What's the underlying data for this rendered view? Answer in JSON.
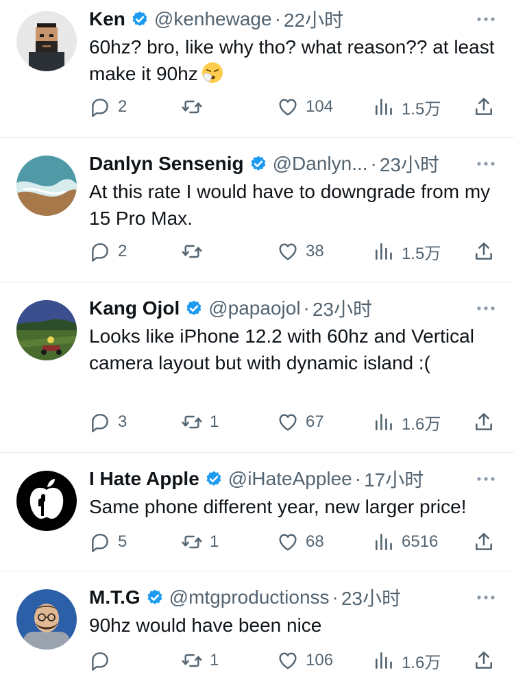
{
  "tweets": [
    {
      "name": "Ken",
      "handle": "@kenhewage",
      "time": "22小时",
      "text": "60hz? bro, like why tho? what reason?? at least make it 90hz",
      "replies": "2",
      "retweets": "",
      "likes": "104",
      "views": "1.5万",
      "avatar": "pixel-art-man-avatar"
    },
    {
      "name": "Danlyn Sensenig",
      "handle": "@Danlyn...",
      "time": "23小时",
      "text": "At this rate I would have to downgrade from my 15 Pro Max.",
      "replies": "2",
      "retweets": "",
      "likes": "38",
      "views": "1.5万",
      "avatar": "beach-aerial-avatar"
    },
    {
      "name": "Kang Ojol",
      "handle": "@papaojol",
      "time": "23小时",
      "text": "Looks like iPhone 12.2 with 60hz and Vertical camera layout but with dynamic island :(",
      "replies": "3",
      "retweets": "1",
      "likes": "67",
      "views": "1.6万",
      "avatar": "motorbike-landscape-avatar"
    },
    {
      "name": "I Hate Apple",
      "handle": "@iHateApplee",
      "time": "17小时",
      "text": "Same phone different year, new larger price!",
      "replies": "5",
      "retweets": "1",
      "likes": "68",
      "views": "6516",
      "avatar": "apple-logo-avatar"
    },
    {
      "name": "M.T.G",
      "handle": "@mtgproductionss",
      "time": "23小时",
      "text": "90hz would have been nice",
      "replies": "",
      "retweets": "1",
      "likes": "106",
      "views": "1.6万",
      "avatar": "man-glasses-avatar"
    }
  ],
  "separator": "·",
  "colors": {
    "verified": "#1d9bf0",
    "muted": "#536471",
    "text": "#0f1419",
    "divider": "#e6ecf0"
  }
}
